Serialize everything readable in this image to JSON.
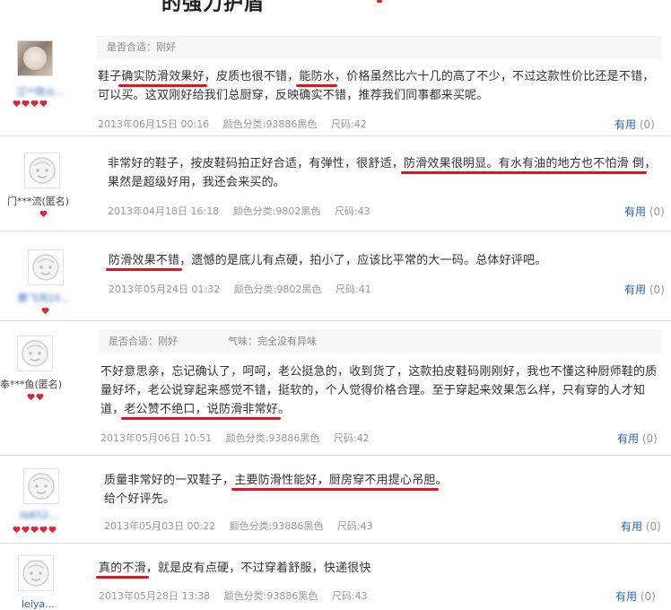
{
  "page_header": {
    "title": "的强力护盾"
  },
  "reviews": [
    {
      "user": {
        "name": "江**防火...",
        "avatar": "cat-photo",
        "hearts": 4
      },
      "meta": {
        "fit_label": "是否合适：",
        "fit_value": "刚好"
      },
      "content": [
        {
          "t": "鞋子"
        },
        {
          "t": "确实防滑效果好",
          "u": true
        },
        {
          "t": "，皮质也很不错，"
        },
        {
          "t": "能防水",
          "u": true
        },
        {
          "t": "，价格虽然比六十几的高了不少，不过这款性价比还是不错，可以买。这双刚好给我们总厨穿，反映确实不错，推荐我们同事都来买呢。"
        }
      ],
      "date": "2013年06月15日 00:16",
      "color": "颜色分类:93886黑色",
      "size": "尺码:42",
      "useful_label": "有用",
      "useful_count": "(0)"
    },
    {
      "user": {
        "name": "门***流(匿名)",
        "avatar": "default",
        "hearts": 1
      },
      "content": [
        {
          "t": "非常好的鞋子，按皮鞋码拍正好合适，有弹性，很舒适，"
        },
        {
          "t": "防滑效果很明显。有水有油的地方也不怕滑",
          "u": true
        },
        {
          "t": " "
        },
        {
          "t": "倒",
          "u": true
        },
        {
          "t": "，果然是超级好用，我还会来买的。"
        }
      ],
      "date": "2013年04月18日 16:18",
      "color": "颜色分类:9802黑色",
      "size": "尺码:43",
      "useful_label": "有用",
      "useful_count": "(0)"
    },
    {
      "user": {
        "name": "鄭飞鸿10...",
        "avatar": "default",
        "hearts": 1
      },
      "content": [
        {
          "t": "防滑效果不错",
          "u": true
        },
        {
          "t": "，遗憾的是底儿有点硬，拍小了，应该比平常的大一码。总体好评吧。"
        }
      ],
      "date": "2013年05月24日 01:32",
      "color": "颜色分类:9802黑色",
      "size": "尺码:41",
      "useful_label": "有用",
      "useful_count": "(0)"
    },
    {
      "user": {
        "name": "奉***鱼(匿名)",
        "avatar": "default",
        "hearts": 2
      },
      "meta": {
        "fit_label": "是否合适：",
        "fit_value": "刚好",
        "smell_label": "气味：",
        "smell_value": "完全没有异味"
      },
      "content": [
        {
          "t": "不好意思亲，忘记确认了，呵呵，老公挺急的，收到货了，这款拍皮鞋码刚刚好，我也不懂这种厨师鞋的质量好坏，老公说穿起来感觉不错，挺软的，个人觉得价格合理。至于穿起来效果怎么样，只有穿的人才知道，"
        },
        {
          "t": "老公赞不绝口，说防滑非常好",
          "u": true
        },
        {
          "t": "。"
        }
      ],
      "date": "2013年05月06日 10:51",
      "color": "颜色分类:93886黑色",
      "size": "尺码:42",
      "useful_label": "有用",
      "useful_count": "(0)"
    },
    {
      "user": {
        "name": "tb652...",
        "avatar": "default",
        "hearts": 5
      },
      "content": [
        {
          "t": "质量非常好的一双鞋子，"
        },
        {
          "t": "主要防滑性能好，厨房穿不用提心吊胆",
          "u": true
        },
        {
          "t": "。"
        },
        {
          "br": true
        },
        {
          "t": "给个好评先。"
        }
      ],
      "date": "2013年05月03日 00:22",
      "color": "颜色分类:93886黑色",
      "size": "尺码:43",
      "useful_label": "有用",
      "useful_count": "(0)"
    },
    {
      "user": {
        "name": "leiya...",
        "avatar": "default",
        "hearts": 0
      },
      "content": [
        {
          "t": "真的不滑",
          "u": true
        },
        {
          "t": "，就是皮有点硬，不过穿着舒服，快递很快"
        }
      ],
      "date": "2013年05月28日 13:38",
      "color": "颜色分类:93886黑色",
      "size": "尺码:43",
      "useful_label": "有用",
      "useful_count": "(0)"
    }
  ]
}
